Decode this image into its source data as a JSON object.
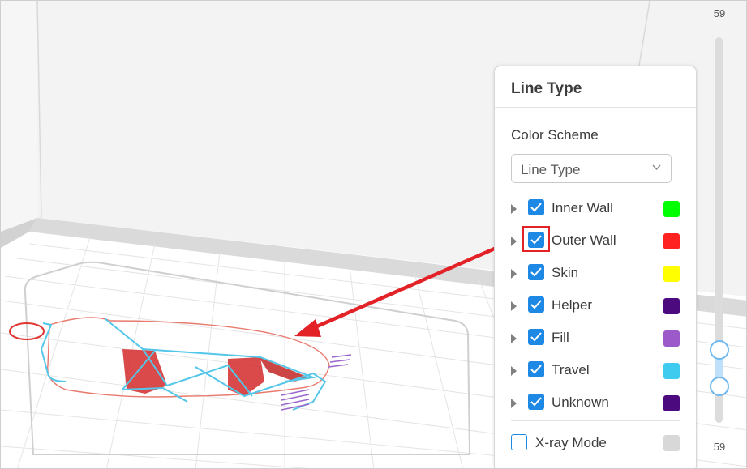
{
  "panel": {
    "title": "Line Type",
    "color_scheme_label": "Color Scheme",
    "color_scheme_value": "Line Type",
    "line_types": [
      {
        "label": "Inner Wall",
        "checked": true,
        "color": "#00ff00"
      },
      {
        "label": "Outer Wall",
        "checked": true,
        "color": "#ff2020",
        "highlighted": true
      },
      {
        "label": "Skin",
        "checked": true,
        "color": "#ffff00"
      },
      {
        "label": "Helper",
        "checked": true,
        "color": "#4b0a7e"
      },
      {
        "label": "Fill",
        "checked": true,
        "color": "#9b59c9"
      },
      {
        "label": "Travel",
        "checked": true,
        "color": "#3fcaf0"
      },
      {
        "label": "Unknown",
        "checked": true,
        "color": "#4b0a7e"
      }
    ],
    "xray": {
      "label": "X-ray Mode",
      "checked": false,
      "color": "#d8d8d8"
    }
  },
  "layer_slider": {
    "top_label": "59",
    "bottom_label": "59"
  },
  "colors": {
    "accent": "#1e88e5",
    "annotation": "#e32228"
  }
}
